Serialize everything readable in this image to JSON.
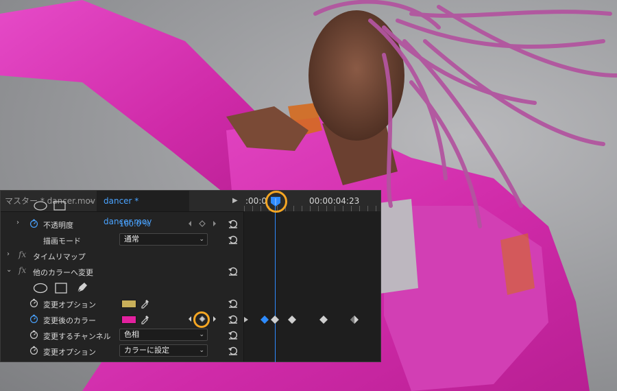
{
  "panel": {
    "tab_master": "マスター * dancer.mov",
    "tab_clip": "dancer * dancer.mov",
    "timecode_start": ":00:0",
    "timecode_end": "00:00:04:23"
  },
  "rows": {
    "opacity_label": "不透明度",
    "opacity_value": "100.0 %",
    "blend_mode_label": "描画モード",
    "blend_mode_value": "通常",
    "time_remap_label": "タイムリマップ",
    "effect_name": "他のカラーへ変更",
    "from_color_label": "変更オプション",
    "to_color_label": "変更後のカラー",
    "channel_label": "変更するチャンネル",
    "channel_value": "色相",
    "change_option_label": "変更オプション",
    "change_option_value": "カラーに設定",
    "fx_symbol": "fx"
  },
  "colors": {
    "from_color": "#c9b05a",
    "to_color": "#e3219f",
    "accent": "#2e8bff",
    "highlight": "#f5a623"
  },
  "icons": [
    "chevron-right-icon",
    "stopwatch-icon",
    "reset-icon",
    "eyedropper-icon",
    "ellipse-mask-icon",
    "rectangle-mask-icon",
    "pen-mask-icon",
    "keyframe-diamond-icon",
    "play-icon",
    "playhead-icon"
  ]
}
